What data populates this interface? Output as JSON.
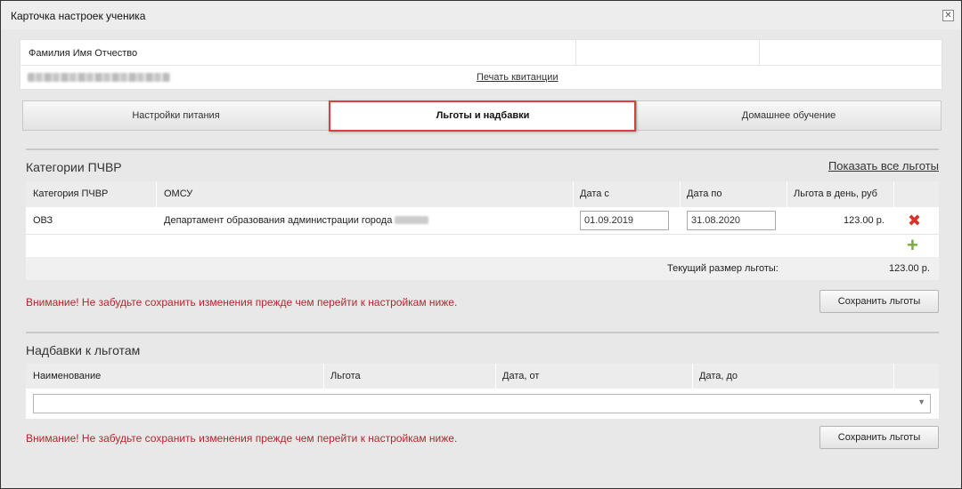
{
  "window": {
    "title": "Карточка настроек ученика",
    "close_icon": "close-icon"
  },
  "student": {
    "fio_label": "Фамилия Имя Отчество",
    "print_link": "Печать квитанции"
  },
  "tabs": [
    {
      "label": "Настройки питания",
      "active": false
    },
    {
      "label": "Льготы и надбавки",
      "active": true
    },
    {
      "label": "Домашнее обучение",
      "active": false
    }
  ],
  "categories": {
    "title": "Категории ПЧВР",
    "show_all_link": "Показать все льготы",
    "columns": [
      "Категория ПЧВР",
      "ОМСУ",
      "Дата с",
      "Дата по",
      "Льгота в день, руб"
    ],
    "rows": [
      {
        "category": "ОВЗ",
        "omsu": "Департамент образования администрации города",
        "date_from": "01.09.2019",
        "date_to": "31.08.2020",
        "amount": "123.00 р."
      }
    ],
    "total_label": "Текущий размер льготы:",
    "total_value": "123.00 р.",
    "warning": "Внимание! Не забудьте сохранить изменения прежде чем перейти к настройкам ниже.",
    "save_button": "Сохранить льготы"
  },
  "allowances": {
    "title": "Надбавки к льготам",
    "columns": [
      "Наименование",
      "Льгота",
      "Дата, от",
      "Дата, до"
    ],
    "select_value": "",
    "warning": "Внимание! Не забудьте сохранить изменения прежде чем перейти к настройкам ниже.",
    "save_button": "Сохранить льготы"
  },
  "colors": {
    "warning": "#b3272d",
    "highlight": "#d94141",
    "delete": "#d9342b",
    "add": "#7aa83a"
  }
}
